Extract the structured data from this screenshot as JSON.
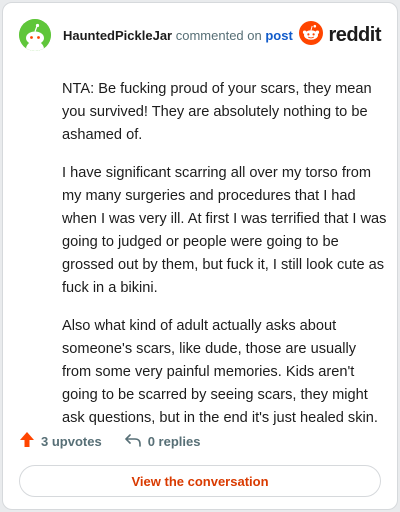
{
  "header": {
    "username": "HauntedPickleJar",
    "action_text": "commented on",
    "target_label": "post",
    "brand_name": "reddit"
  },
  "comment": {
    "paragraphs": [
      "NTA: Be fucking proud of your scars, they mean you survived! They are absolutely nothing to be ashamed of.",
      "I have significant scarring all over my torso from my many surgeries and procedures that I had when I was very ill. At first I was terrified that I was going to judged or people were going to be grossed out by them, but fuck it, I still look cute as fuck in a bikini.",
      "Also what kind of adult actually asks about someone's scars, like dude, those are usually from some very painful memories. Kids aren't going to be scarred by seeing scars, they might ask questions, but in the end it's just healed skin."
    ]
  },
  "actions": {
    "upvotes_label": "3 upvotes",
    "replies_label": "0 replies"
  },
  "cta": {
    "label": "View the conversation"
  },
  "colors": {
    "reddit_orange": "#ff4500",
    "link_blue": "#115bca",
    "cta_text": "#d93a00",
    "avatar_green": "#5fc63a"
  },
  "icons": {
    "avatar": "snoo-avatar-icon",
    "brand": "reddit-logo-icon",
    "upvote": "upvote-arrow-icon",
    "reply": "reply-arrow-icon"
  }
}
